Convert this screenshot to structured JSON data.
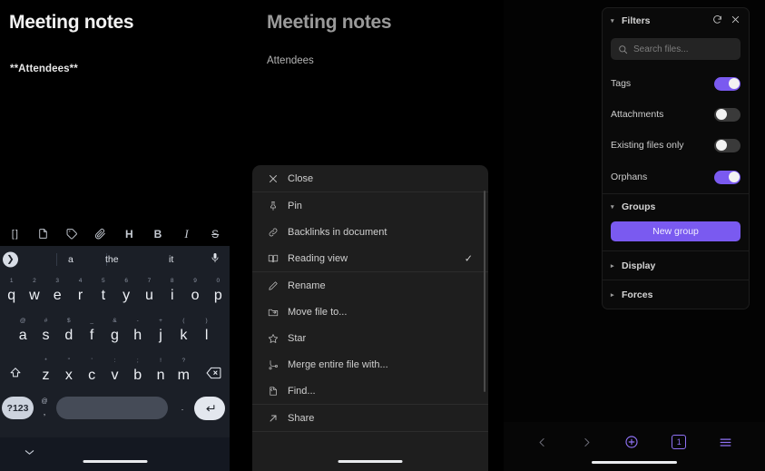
{
  "left_panel": {
    "document": {
      "title": "Meeting notes",
      "body_line": "**Attendees**"
    },
    "editor_toolbar": [
      {
        "name": "brackets-icon",
        "glyph": "[]",
        "label": "Insert link brackets"
      },
      {
        "name": "new-note-icon",
        "glyph": "",
        "label": "New note"
      },
      {
        "name": "tag-icon",
        "glyph": "",
        "label": "Tag"
      },
      {
        "name": "paperclip-icon",
        "glyph": "",
        "label": "Attach"
      },
      {
        "name": "heading-icon",
        "glyph": "H",
        "label": "Heading"
      },
      {
        "name": "bold-icon",
        "glyph": "B",
        "label": "Bold"
      },
      {
        "name": "italic-icon",
        "glyph": "I",
        "label": "Italic"
      },
      {
        "name": "strikethrough-icon",
        "glyph": "S",
        "label": "Strikethrough"
      }
    ],
    "keyboard": {
      "suggestions": [
        "a",
        "the",
        "it"
      ],
      "expand_icon": "chevron-right-icon",
      "mic_icon": "microphone-icon",
      "row1": [
        {
          "key": "q",
          "hint": "1"
        },
        {
          "key": "w",
          "hint": "2"
        },
        {
          "key": "e",
          "hint": "3"
        },
        {
          "key": "r",
          "hint": "4"
        },
        {
          "key": "t",
          "hint": "5"
        },
        {
          "key": "y",
          "hint": "6"
        },
        {
          "key": "u",
          "hint": "7"
        },
        {
          "key": "i",
          "hint": "8"
        },
        {
          "key": "o",
          "hint": "9"
        },
        {
          "key": "p",
          "hint": "0"
        }
      ],
      "row2": [
        {
          "key": "a",
          "hint": "@"
        },
        {
          "key": "s",
          "hint": "#"
        },
        {
          "key": "d",
          "hint": "$"
        },
        {
          "key": "f",
          "hint": "_"
        },
        {
          "key": "g",
          "hint": "&"
        },
        {
          "key": "h",
          "hint": "-"
        },
        {
          "key": "j",
          "hint": "+"
        },
        {
          "key": "k",
          "hint": "("
        },
        {
          "key": "l",
          "hint": ")"
        }
      ],
      "row3": [
        {
          "key": "z",
          "hint": "*"
        },
        {
          "key": "x",
          "hint": "\""
        },
        {
          "key": "c",
          "hint": "'"
        },
        {
          "key": "v",
          "hint": ":"
        },
        {
          "key": "b",
          "hint": ";"
        },
        {
          "key": "n",
          "hint": "!"
        },
        {
          "key": "m",
          "hint": "?"
        }
      ],
      "shift_icon": "shift-icon",
      "backspace_icon": "backspace-icon",
      "symbols_key": "?123",
      "comma_key": {
        "top": "@",
        "bottom": ","
      },
      "period_key": {
        "top": "",
        "bottom": "."
      },
      "enter_icon": "enter-icon",
      "dismiss_icon": "chevron-down-icon"
    }
  },
  "middle_panel": {
    "document": {
      "title": "Meeting notes",
      "body_line": "Attendees"
    },
    "context_menu": {
      "groups": [
        {
          "items": [
            {
              "label": "Close",
              "icon": "close-icon",
              "checked": false
            }
          ]
        },
        {
          "items": [
            {
              "label": "Pin",
              "icon": "pin-icon",
              "checked": false
            },
            {
              "label": "Backlinks in document",
              "icon": "backlink-icon",
              "checked": false
            },
            {
              "label": "Reading view",
              "icon": "book-open-icon",
              "checked": true
            }
          ]
        },
        {
          "items": [
            {
              "label": "Rename",
              "icon": "pencil-icon",
              "checked": false
            },
            {
              "label": "Move file to...",
              "icon": "move-file-icon",
              "checked": false
            },
            {
              "label": "Star",
              "icon": "star-icon",
              "checked": false
            },
            {
              "label": "Merge entire file with...",
              "icon": "merge-icon",
              "checked": false
            },
            {
              "label": "Find...",
              "icon": "find-icon",
              "checked": false
            }
          ]
        },
        {
          "items": [
            {
              "label": "Share",
              "icon": "share-arrow-icon",
              "checked": false
            }
          ]
        }
      ],
      "check_glyph": "✓"
    }
  },
  "right_panel": {
    "filters": {
      "title": "Filters",
      "expanded": true,
      "reset_icon": "reset-icon",
      "close_icon": "close-icon",
      "search": {
        "placeholder": "Search files...",
        "value": "",
        "icon": "search-icon"
      },
      "toggles": [
        {
          "label": "Tags",
          "on": true
        },
        {
          "label": "Attachments",
          "on": false
        },
        {
          "label": "Existing files only",
          "on": false
        },
        {
          "label": "Orphans",
          "on": true
        }
      ]
    },
    "groups": {
      "title": "Groups",
      "expanded": true,
      "new_group_label": "New group"
    },
    "display": {
      "title": "Display",
      "expanded": false
    },
    "forces": {
      "title": "Forces",
      "expanded": false
    },
    "bottom_nav": [
      {
        "name": "back-button",
        "icon": "chevron-left-icon",
        "accent": false,
        "label": ""
      },
      {
        "name": "forward-button",
        "icon": "chevron-right-icon",
        "accent": false,
        "label": ""
      },
      {
        "name": "add-button",
        "icon": "plus-circle-icon",
        "accent": true,
        "label": ""
      },
      {
        "name": "tab-switcher",
        "icon": "tab-count-icon",
        "accent": true,
        "label": "1"
      },
      {
        "name": "menu-button",
        "icon": "hamburger-icon",
        "accent": true,
        "label": ""
      }
    ]
  },
  "accent_colors": {
    "purple": "#7a5af0",
    "purple_light": "#8f72f5",
    "keyboard_bg": "#1b1f27",
    "menu_bg": "#1e1e1e",
    "panel_bg": "#000000"
  }
}
